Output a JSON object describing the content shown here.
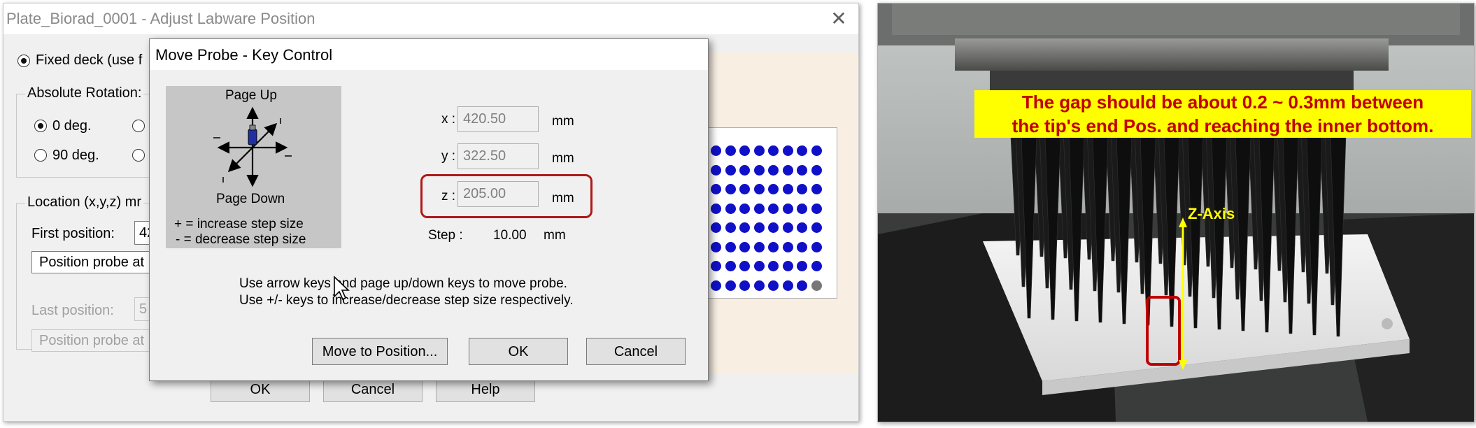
{
  "window": {
    "title": "Plate_Biorad_0001 - Adjust Labware Position",
    "close_label": "✕",
    "fixed_deck_label": "Fixed deck (use f",
    "absolute_rotation_label": "Absolute Rotation:",
    "rotation_0_label": "0 deg.",
    "rotation_90_label": "90 deg.",
    "location_label": "Location (x,y,z) mr",
    "first_position_label": "First position:",
    "first_position_value": "42",
    "position_probe_1_label": "Position probe at",
    "last_position_label": "Last position:",
    "last_position_value": "5",
    "position_probe_2_label": "Position probe at",
    "ok_label": "OK",
    "cancel_label": "Cancel",
    "help_label": "Help"
  },
  "dialog": {
    "title": "Move Probe - Key Control",
    "page_up_label": "Page Up",
    "page_down_label": "Page Down",
    "increase_hint": "+ = increase step size",
    "decrease_hint": "- = decrease step size",
    "x_label": "x :",
    "x_value": "420.50",
    "y_label": "y :",
    "y_value": "322.50",
    "z_label": "z :",
    "z_value": "205.00",
    "unit": "mm",
    "step_label": "Step :",
    "step_value": "10.00",
    "instruction_line1": "Use arrow keys and page up/down keys to move probe.",
    "instruction_line2": "Use +/- keys to increase/decrease step size respectively.",
    "move_to_position_label": "Move to Position...",
    "ok_label": "OK",
    "cancel_label": "Cancel"
  },
  "photo": {
    "annotation_line1": "The gap should be about 0.2 ~ 0.3mm between",
    "annotation_line2": "the tip's end Pos. and reaching the inner bottom.",
    "z_axis_label": "Z-Axis"
  },
  "colors": {
    "highlight_red": "#b01818",
    "annotation_yellow": "#ffff00",
    "annotation_text_red": "#c00000",
    "well_blue": "#1010c8"
  }
}
